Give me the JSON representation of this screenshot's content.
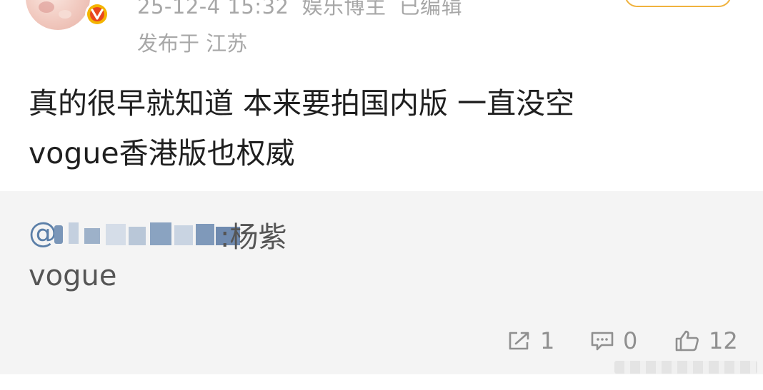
{
  "post": {
    "timestamp": "25-12-4 15:32",
    "author_tag": "娱乐博主",
    "edited_label": "已编辑",
    "location": "发布于 江苏",
    "content_lines": [
      "真的很早就知道 本来要拍国内版 一直没空",
      "vogue香港版也权威"
    ]
  },
  "quote": {
    "at_symbol": "@",
    "name_suffix": ":杨紫",
    "text": "vogue"
  },
  "actions": {
    "share_count": "1",
    "comment_count": "0",
    "like_count": "12"
  },
  "colors": {
    "accent_follow": "#f0b23d",
    "verified_badge": "#e9471f",
    "link_blue": "#5b7fa8"
  }
}
